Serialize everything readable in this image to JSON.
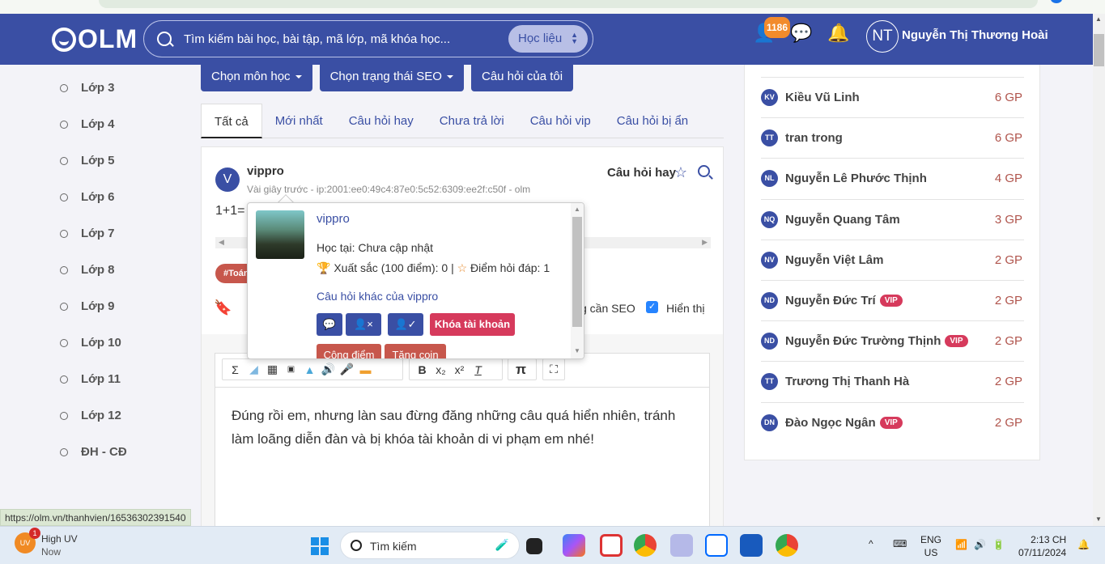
{
  "header": {
    "logo": "OLM",
    "search_placeholder": "Tìm kiếm bài học, bài tập, mã lớp, mã khóa học...",
    "search_scope": "Học liệu",
    "friend_badge": "1186",
    "user_initials": "NT",
    "user_name": "Nguyễn Thị Thương Hoài"
  },
  "sidebar": {
    "items": [
      "Lớp 3",
      "Lớp 4",
      "Lớp 5",
      "Lớp 6",
      "Lớp 7",
      "Lớp 8",
      "Lớp 9",
      "Lớp 10",
      "Lớp 11",
      "Lớp 12",
      "ĐH - CĐ"
    ]
  },
  "filters": {
    "subject": "Chọn môn học",
    "seo_status": "Chọn trạng thái SEO",
    "my_questions": "Câu hỏi của tôi"
  },
  "tabs": [
    "Tất cả",
    "Mới nhất",
    "Câu hỏi hay",
    "Chưa trả lời",
    "Câu hỏi vip",
    "Câu hỏi bị ẩn"
  ],
  "post": {
    "avatar_initial": "V",
    "author": "vippro",
    "meta": "Vài giây trước - ip:2001:ee0:49c4:87e0:5c52:6309:ee2f:c50f - olm",
    "label": "Câu hỏi hay",
    "question": "1+1=",
    "tag": "#Toán",
    "seo_label": "g cần SEO",
    "show_label": "Hiển thị",
    "show_checked": true
  },
  "popup": {
    "name": "vippro",
    "study": "Học tại: Chưa cập nhật",
    "excellent": "Xuất sắc (100 điểm): 0 |",
    "qa_points": "Điểm hỏi đáp: 1",
    "other_questions": "Câu hỏi khác của vippro",
    "lock_account": "Khóa tài khoản",
    "add_points": "Cộng điểm",
    "give_coin": "Tặng coin"
  },
  "editor": {
    "text": "Đúng rồi em, nhưng làn sau đừng đăng những câu quá hiển nhiên, tránh làm loãng diễn đàn và bị khóa tài khoản di vi phạm em nhé!"
  },
  "leaderboard": [
    {
      "initials": "KV",
      "name": "Kiều Vũ Linh",
      "vip": false,
      "gp": "6 GP"
    },
    {
      "initials": "TT",
      "name": "tran trong",
      "vip": false,
      "gp": "6 GP"
    },
    {
      "initials": "NL",
      "name": "Nguyễn Lê Phước Thịnh",
      "vip": false,
      "gp": "4 GP"
    },
    {
      "initials": "NQ",
      "name": "Nguyễn Quang Tâm",
      "vip": false,
      "gp": "3 GP"
    },
    {
      "initials": "NV",
      "name": "Nguyễn Việt Lâm",
      "vip": false,
      "gp": "2 GP"
    },
    {
      "initials": "ND",
      "name": "Nguyễn Đức Trí",
      "vip": true,
      "gp": "2 GP"
    },
    {
      "initials": "ND",
      "name": "Nguyễn Đức Trường Thịnh",
      "vip": true,
      "gp": "2 GP"
    },
    {
      "initials": "TT",
      "name": "Trương Thị Thanh Hà",
      "vip": false,
      "gp": "2 GP"
    },
    {
      "initials": "DN",
      "name": "Đào Ngọc Ngân",
      "vip": true,
      "gp": "2 GP"
    }
  ],
  "vip_label": "VIP",
  "status_url": "https://olm.vn/thanhvien/16536302391540",
  "taskbar": {
    "weather_title": "High UV",
    "weather_sub": "Now",
    "weather_badge": "1",
    "weather_icon_text": "UV",
    "search_label": "Tìm kiếm",
    "lang_top": "ENG",
    "lang_bottom": "US",
    "time": "2:13 CH",
    "date": "07/11/2024"
  },
  "colors": {
    "brand": "#3a4fa4",
    "vip": "#d63a5c",
    "gp": "#b0544c"
  }
}
